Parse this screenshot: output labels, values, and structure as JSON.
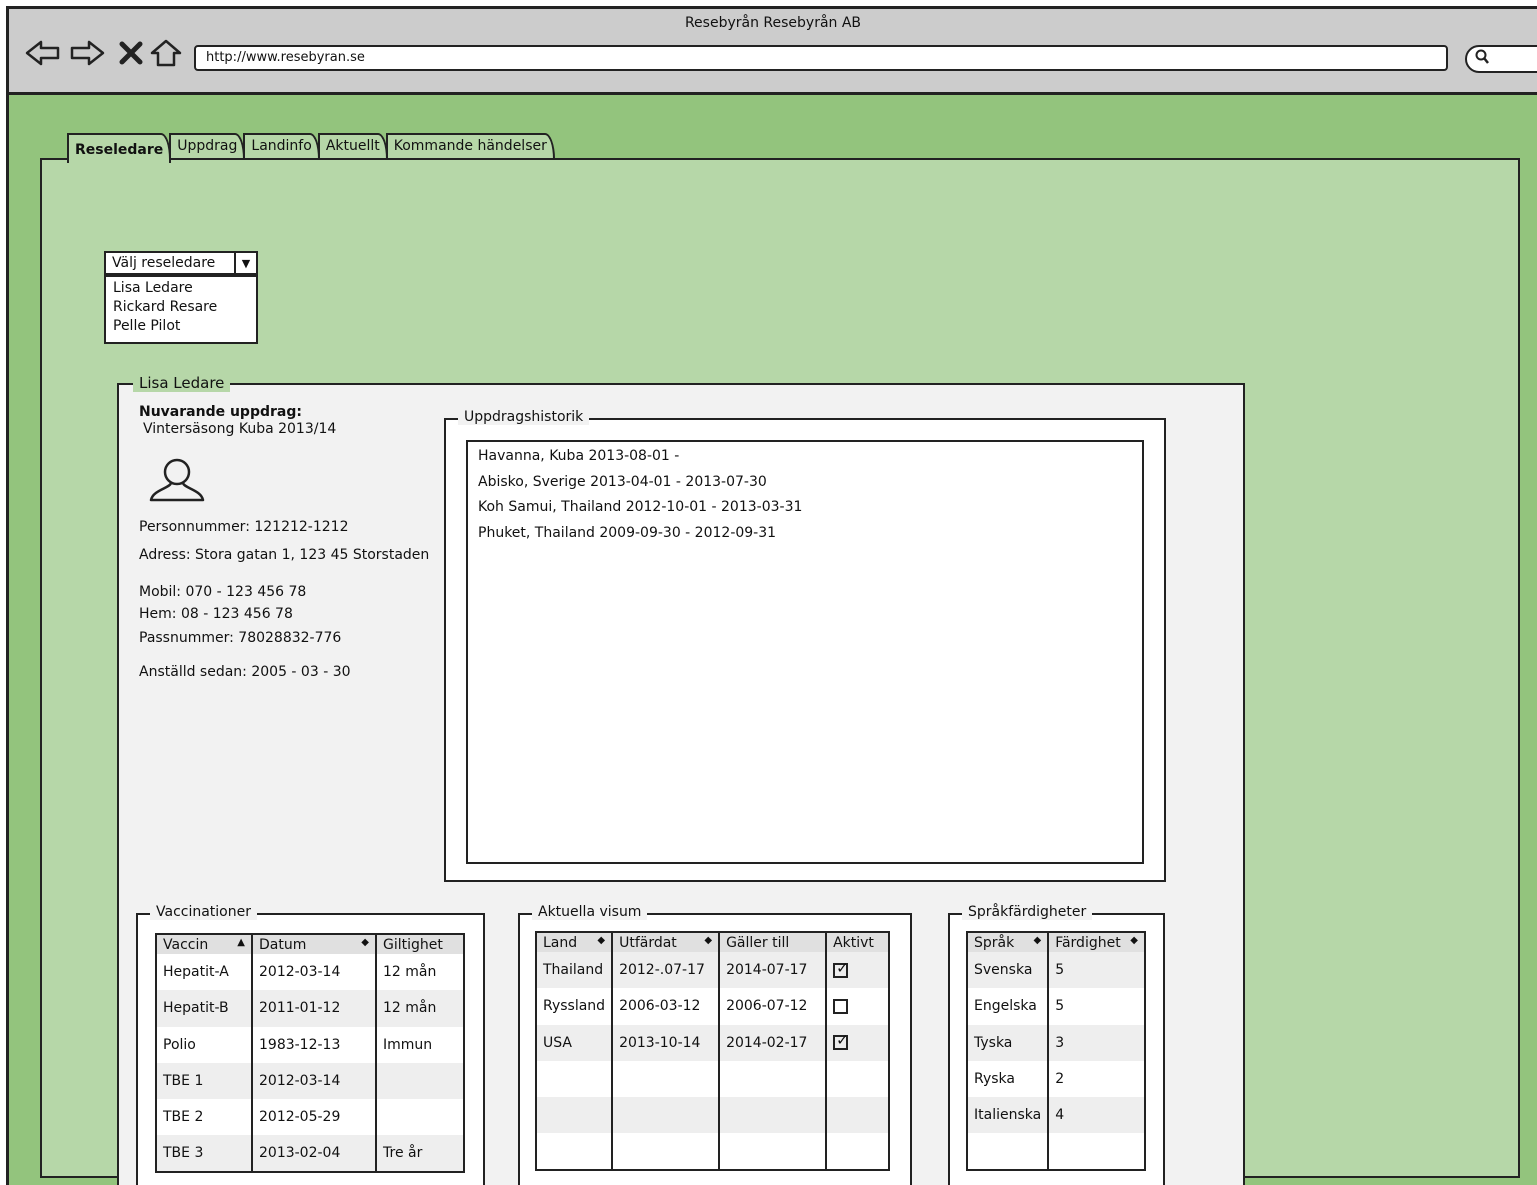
{
  "browser": {
    "title": "Resebyrån Resebyrån AB",
    "url": "http://www.resebyran.se",
    "icons": [
      "back-icon",
      "forward-icon",
      "stop-icon",
      "home-icon",
      "search-icon"
    ]
  },
  "tabs": [
    {
      "label": "Reseledare",
      "active": true
    },
    {
      "label": "Uppdrag",
      "active": false
    },
    {
      "label": "Landinfo",
      "active": false
    },
    {
      "label": "Aktuellt",
      "active": false
    },
    {
      "label": "Kommande händelser",
      "active": false
    }
  ],
  "guide_select": {
    "value": "Välj reseledare",
    "options": [
      "Lisa Ledare",
      "Rickard Resare",
      "Pelle Pilot"
    ]
  },
  "profile": {
    "legend": "Lisa Ledare",
    "current_label": "Nuvarande uppdrag:",
    "current_value": "Vintersäsong Kuba 2013/14",
    "personnummer": "Personnummer: 121212-1212",
    "adress": "Adress: Stora gatan 1, 123 45 Storstaden",
    "mobil": "Mobil: 070 - 123 456 78",
    "hem": "Hem: 08 - 123 456 78",
    "pass": "Passnummer: 78028832-776",
    "anstalld": "Anställd sedan: 2005 - 03 - 30"
  },
  "history": {
    "legend": "Uppdragshistorik",
    "items": [
      "Havanna, Kuba 2013-08-01 -",
      "Abisko, Sverige 2013-04-01 - 2013-07-30",
      "Koh Samui, Thailand 2012-10-01 - 2013-03-31",
      "Phuket, Thailand 2009-09-30 - 2012-09-31"
    ]
  },
  "vaccinations": {
    "legend": "Vaccinationer",
    "headers": [
      "Vaccin",
      "Datum",
      "Giltighet"
    ],
    "rows": [
      [
        "Hepatit-A",
        "2012-03-14",
        "12 mån"
      ],
      [
        "Hepatit-B",
        "2011-01-12",
        "12 mån"
      ],
      [
        "Polio",
        "1983-12-13",
        "Immun"
      ],
      [
        "TBE 1",
        "2012-03-14",
        ""
      ],
      [
        "TBE 2",
        "2012-05-29",
        ""
      ],
      [
        "TBE 3",
        "2013-02-04",
        "Tre år"
      ]
    ]
  },
  "visas": {
    "legend": "Aktuella visum",
    "headers": [
      "Land",
      "Utfärdat",
      "Gäller till",
      "Aktivt"
    ],
    "rows": [
      [
        "Thailand",
        "2012-.07-17",
        "2014-07-17",
        true
      ],
      [
        "Ryssland",
        "2006-03-12",
        "2006-07-12",
        false
      ],
      [
        "USA",
        "2013-10-14",
        "2014-02-17",
        true
      ],
      [
        "",
        "",
        "",
        null
      ],
      [
        "",
        "",
        "",
        null
      ],
      [
        "",
        "",
        "",
        null
      ]
    ]
  },
  "languages": {
    "legend": "Språkfärdigheter",
    "headers": [
      "Språk",
      "Färdighet"
    ],
    "rows": [
      [
        "Svenska",
        "5"
      ],
      [
        "Engelska",
        "5"
      ],
      [
        "Tyska",
        "3"
      ],
      [
        "Ryska",
        "2"
      ],
      [
        "Italienska",
        "4"
      ],
      [
        "",
        ""
      ]
    ]
  }
}
